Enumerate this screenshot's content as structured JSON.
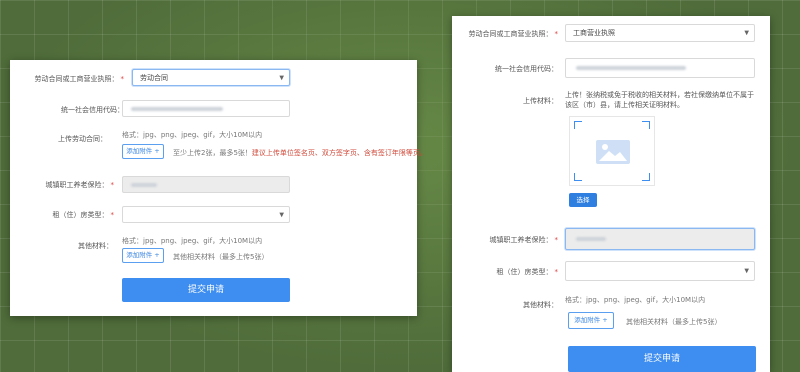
{
  "left_form": {
    "license": {
      "label": "劳动合同或工商营业执照：",
      "value": "劳动合同"
    },
    "credit_code": {
      "label": "统一社会信用代码："
    },
    "upload_contract": {
      "label": "上传劳动合同：",
      "format_note": "格式：jpg、png、jpeg、gif，大小10M以内",
      "add_button": "添加附件 +",
      "count_note": "至少上传2张，最多5张！",
      "warning": "建议上传单位签名页、双方签字页、含有签订年限等页。"
    },
    "pension": {
      "label": "城镇职工养老保险："
    },
    "house_type": {
      "label": "租（住）房类型："
    },
    "other": {
      "label": "其他材料：",
      "format_note": "格式：jpg、png、jpeg、gif，大小10M以内",
      "add_button": "添加附件 +",
      "note": "其他相关材料（最多上传5张）"
    },
    "submit": "提交申请"
  },
  "right_form": {
    "license": {
      "label": "劳动合同或工商营业执照：",
      "value": "工商营业执照"
    },
    "credit_code": {
      "label": "统一社会信用代码："
    },
    "upload": {
      "label": "上传材料：",
      "hint": "上传！张纳税或免于税收的相关材料，若社保缴纳单位不属于该区（市）县，请上传相关证明材料。",
      "choose_button": "选择"
    },
    "pension": {
      "label": "城镇职工养老保险："
    },
    "house_type": {
      "label": "租（住）房类型："
    },
    "other": {
      "label": "其他材料：",
      "format_note": "格式：jpg、png、jpeg、gif，大小10M以内",
      "add_button": "添加附件 +",
      "note": "其他相关材料（最多上传5张）"
    },
    "submit": "提交申请"
  },
  "icons": {
    "select_caret": "caret-down-icon",
    "required": "asterisk",
    "upload_placeholder": "image-icon"
  },
  "colors": {
    "primary": "#3d8ef0",
    "warning": "#d04a3a",
    "required": "#e04040",
    "background": "#4f6c3a"
  }
}
